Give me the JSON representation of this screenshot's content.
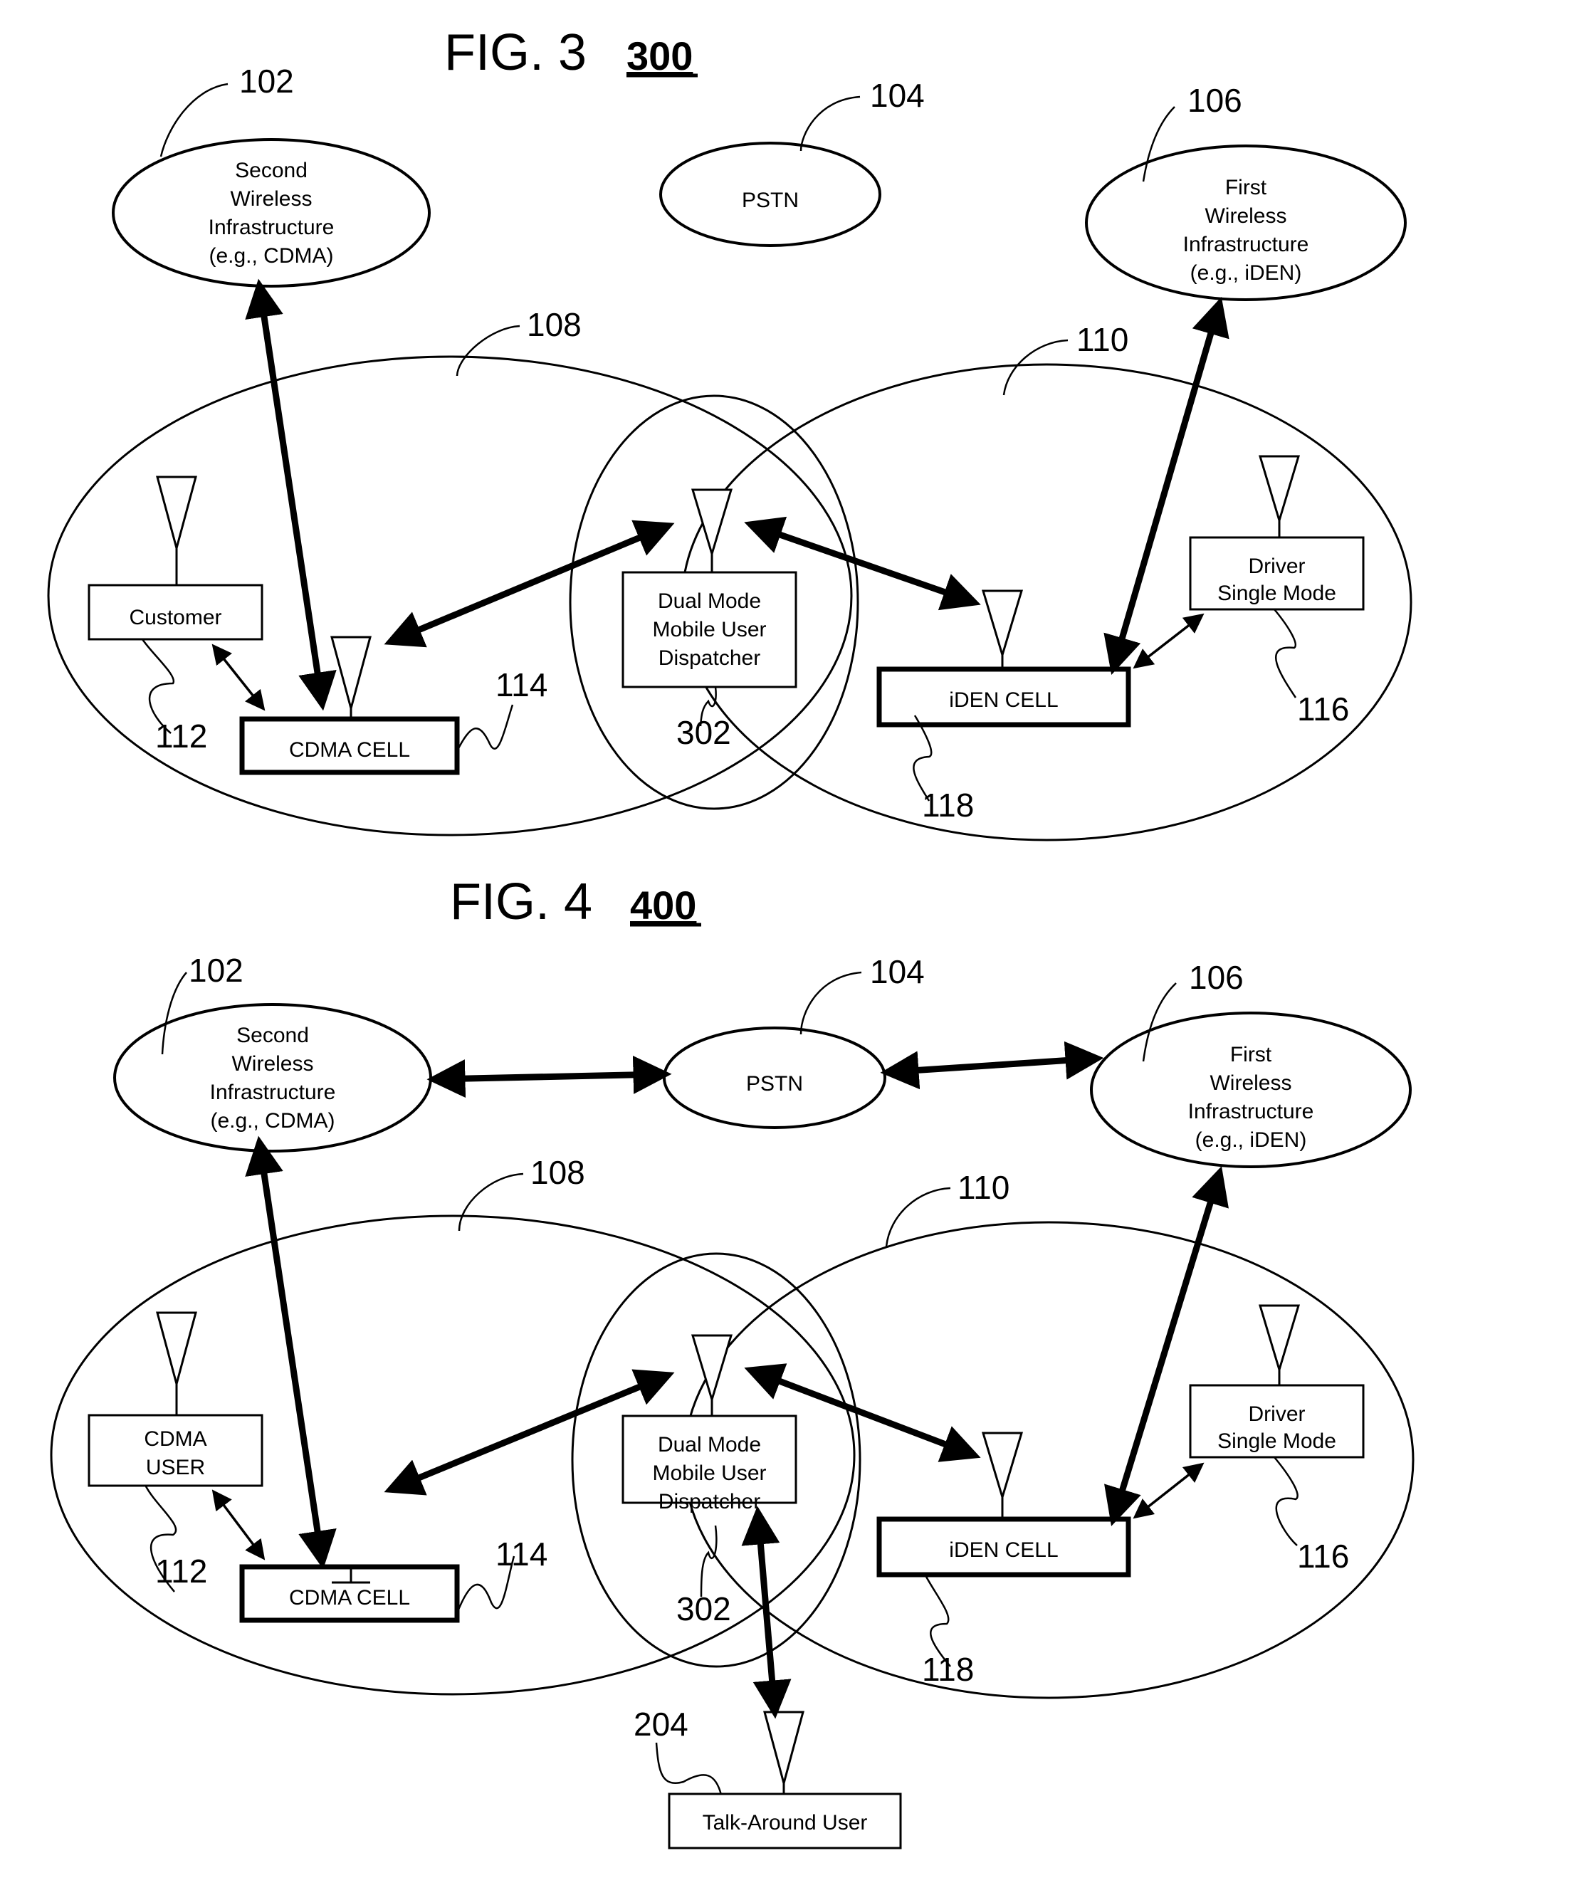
{
  "figures": [
    {
      "id": "fig3",
      "title": "FIG. 3",
      "number": "300",
      "nodes": {
        "second_infra": {
          "lines": [
            "Second",
            "Wireless",
            "Infrastructure",
            "(e.g., CDMA)"
          ],
          "ref": "102"
        },
        "pstn": {
          "lines": [
            "PSTN"
          ],
          "ref": "104"
        },
        "first_infra": {
          "lines": [
            "First",
            "Wireless",
            "Infrastructure",
            "(e.g., iDEN)"
          ],
          "ref": "106"
        },
        "cdma_coverage": {
          "ref": "108"
        },
        "iden_coverage": {
          "ref": "110"
        },
        "user_box": {
          "lines": [
            "Customer"
          ],
          "ref": "112"
        },
        "cdma_cell": {
          "lines": [
            "CDMA CELL"
          ],
          "ref": "114"
        },
        "dispatcher": {
          "lines": [
            "Dual Mode",
            "Mobile User",
            "Dispatcher"
          ],
          "ref": "302"
        },
        "iden_cell": {
          "lines": [
            "iDEN CELL"
          ],
          "ref": "118"
        },
        "driver": {
          "lines": [
            "Driver",
            "Single Mode"
          ],
          "ref": "116"
        }
      }
    },
    {
      "id": "fig4",
      "title": "FIG. 4",
      "number": "400",
      "nodes": {
        "second_infra": {
          "lines": [
            "Second",
            "Wireless",
            "Infrastructure",
            "(e.g., CDMA)"
          ],
          "ref": "102"
        },
        "pstn": {
          "lines": [
            "PSTN"
          ],
          "ref": "104"
        },
        "first_infra": {
          "lines": [
            "First",
            "Wireless",
            "Infrastructure",
            "(e.g., iDEN)"
          ],
          "ref": "106"
        },
        "cdma_coverage": {
          "ref": "108"
        },
        "iden_coverage": {
          "ref": "110"
        },
        "user_box": {
          "lines": [
            "CDMA",
            "USER"
          ],
          "ref": "112"
        },
        "cdma_cell": {
          "lines": [
            "CDMA CELL"
          ],
          "ref": "114"
        },
        "dispatcher": {
          "lines": [
            "Dual Mode",
            "Mobile User",
            "Dispatcher"
          ],
          "ref": "302"
        },
        "iden_cell": {
          "lines": [
            "iDEN CELL"
          ],
          "ref": "118"
        },
        "driver": {
          "lines": [
            "Driver",
            "Single Mode"
          ],
          "ref": "116"
        },
        "talk_around": {
          "lines": [
            "Talk-Around User"
          ],
          "ref": "204"
        }
      }
    }
  ]
}
